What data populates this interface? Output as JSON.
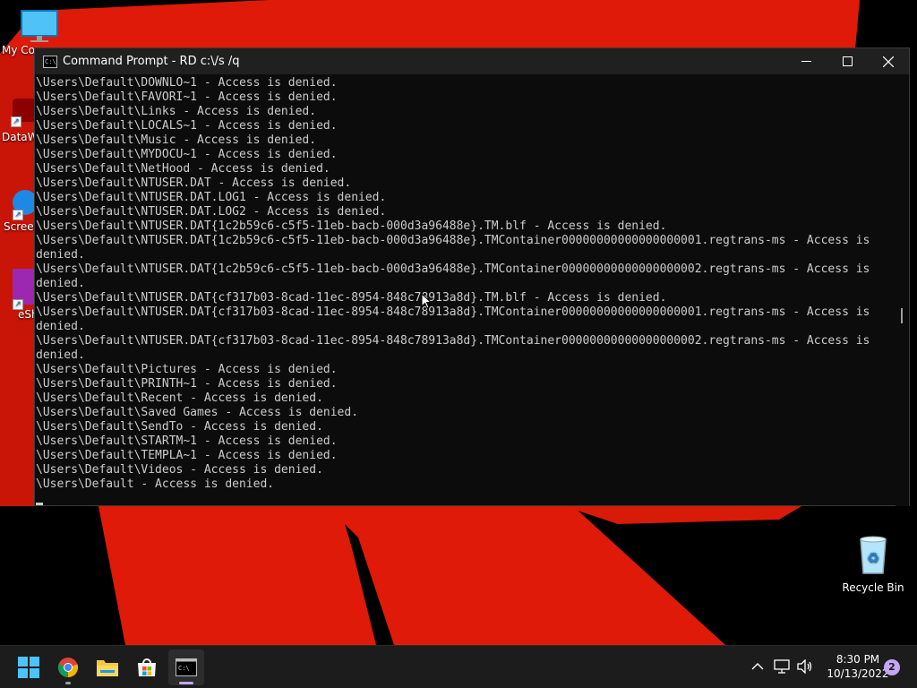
{
  "window": {
    "title": "Command Prompt - RD  c:\\/s /q",
    "minimize_glyph": "—",
    "maximize_glyph": "☐",
    "close_glyph": "✕"
  },
  "console_lines": [
    "\\Users\\Default\\DOWNLO~1 - Access is denied.",
    "\\Users\\Default\\FAVORI~1 - Access is denied.",
    "\\Users\\Default\\Links - Access is denied.",
    "\\Users\\Default\\LOCALS~1 - Access is denied.",
    "\\Users\\Default\\Music - Access is denied.",
    "\\Users\\Default\\MYDOCU~1 - Access is denied.",
    "\\Users\\Default\\NetHood - Access is denied.",
    "\\Users\\Default\\NTUSER.DAT - Access is denied.",
    "\\Users\\Default\\NTUSER.DAT.LOG1 - Access is denied.",
    "\\Users\\Default\\NTUSER.DAT.LOG2 - Access is denied.",
    "\\Users\\Default\\NTUSER.DAT{1c2b59c6-c5f5-11eb-bacb-000d3a96488e}.TM.blf - Access is denied.",
    "\\Users\\Default\\NTUSER.DAT{1c2b59c6-c5f5-11eb-bacb-000d3a96488e}.TMContainer00000000000000000001.regtrans-ms - Access is",
    "denied.",
    "\\Users\\Default\\NTUSER.DAT{1c2b59c6-c5f5-11eb-bacb-000d3a96488e}.TMContainer00000000000000000002.regtrans-ms - Access is",
    "denied.",
    "\\Users\\Default\\NTUSER.DAT{cf317b03-8cad-11ec-8954-848c78913a8d}.TM.blf - Access is denied.",
    "\\Users\\Default\\NTUSER.DAT{cf317b03-8cad-11ec-8954-848c78913a8d}.TMContainer00000000000000000001.regtrans-ms - Access is",
    "denied.",
    "\\Users\\Default\\NTUSER.DAT{cf317b03-8cad-11ec-8954-848c78913a8d}.TMContainer00000000000000000002.regtrans-ms - Access is",
    "denied.",
    "\\Users\\Default\\Pictures - Access is denied.",
    "\\Users\\Default\\PRINTH~1 - Access is denied.",
    "\\Users\\Default\\Recent - Access is denied.",
    "\\Users\\Default\\Saved Games - Access is denied.",
    "\\Users\\Default\\SendTo - Access is denied.",
    "\\Users\\Default\\STARTM~1 - Access is denied.",
    "\\Users\\Default\\TEMPLA~1 - Access is denied.",
    "\\Users\\Default\\Videos - Access is denied.",
    "\\Users\\Default - Access is denied."
  ],
  "desktop_icons": {
    "my_computer": "My Co",
    "dataw": "DataW",
    "screen": "Screen",
    "esh": "eSh",
    "recycle_bin": "Recycle Bin"
  },
  "clock": {
    "time": "8:30 PM",
    "date": "10/13/2022"
  },
  "notification_count": "2",
  "colors": {
    "wallpaper_red": "#e01a08",
    "console_bg": "#0c0c0c",
    "console_text": "#cccccc",
    "taskbar_bg": "#1c1c1c"
  }
}
